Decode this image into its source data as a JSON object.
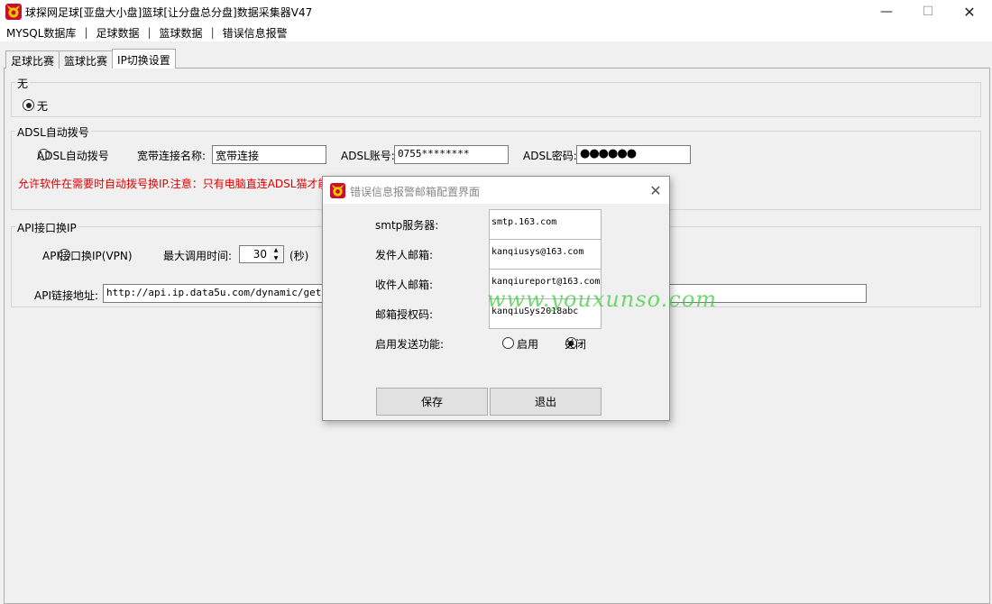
{
  "window": {
    "title": "球探网足球[亚盘大小盘]篮球[让分盘总分盘]数据采集器V47",
    "minimize_glyph": "—",
    "maximize_glyph": "☐",
    "close_glyph": "✕"
  },
  "menu": {
    "items": [
      "MYSQL数据库",
      "足球数据",
      "篮球数据",
      "错误信息报警"
    ],
    "separator": "|"
  },
  "tabs": [
    {
      "label": "足球比赛",
      "active": false
    },
    {
      "label": "篮球比赛",
      "active": false
    },
    {
      "label": "IP切换设置",
      "active": true
    }
  ],
  "group_none": {
    "title": "无",
    "radio_label": "无",
    "checked": true
  },
  "group_adsl": {
    "title": "ADSL自动拨号",
    "radio_label": "ADSL自动拨号",
    "conn_name_label": "宽带连接名称:",
    "conn_name_value": "宽带连接",
    "account_label": "ADSL账号:",
    "account_value": "0755********",
    "password_label": "ADSL密码:",
    "password_value": "●●●●●●",
    "warning": "允许软件在需要时自动拨号换IP.注意：只有电脑直连ADSL猫才能"
  },
  "group_api": {
    "title": "API接口换IP",
    "radio_label": "API接口换IP(VPN)",
    "max_time_label": "最大调用时间:",
    "max_time_value": "30",
    "unit_label": "(秒)",
    "url_label": "API链接地址:",
    "url_value": "http://api.ip.data5u.com/dynamic/get.html"
  },
  "dialog": {
    "title": "错误信息报警邮箱配置界面",
    "close_glyph": "✕",
    "smtp_label": "smtp服务器:",
    "smtp_value": "smtp.163.com",
    "sender_label": "发件人邮箱:",
    "sender_value": "kanqiusys@163.com",
    "receiver_label": "收件人邮箱:",
    "receiver_value": "kanqiureport@163.com",
    "auth_label": "邮箱授权码:",
    "auth_value": "kanqiuSys2018abc",
    "enable_label": "启用发送功能:",
    "enable_option": "启用",
    "disable_option": "关闭",
    "selected": "关闭",
    "save_button": "保存",
    "exit_button": "退出"
  },
  "watermark": "www.youxunso.com",
  "icons": {
    "app_icon": "red-bull-logo-icon",
    "spinner_up": "▲",
    "spinner_down": "▼"
  },
  "colors": {
    "warning_text": "#e00000",
    "watermark": "#44cc44"
  }
}
